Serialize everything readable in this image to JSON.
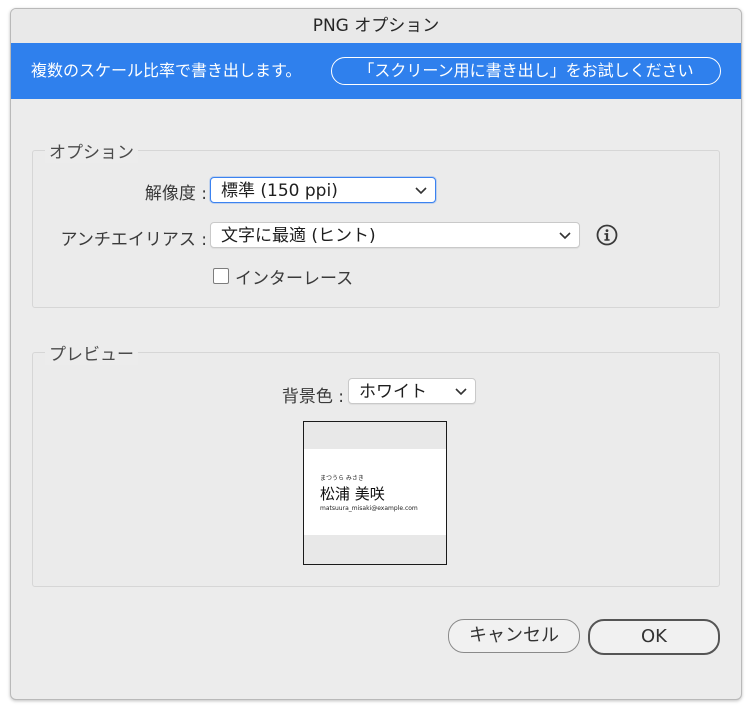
{
  "window": {
    "title": "PNG オプション"
  },
  "banner": {
    "text": "複数のスケール比率で書き出します。",
    "button_label": "「スクリーン用に書き出し」をお試しください",
    "color": "#2f80ed"
  },
  "options": {
    "group_title": "オプション",
    "resolution": {
      "label": "解像度 :",
      "value": "標準 (150 ppi)"
    },
    "antialias": {
      "label": "アンチエイリアス :",
      "value": "文字に最適 (ヒント)",
      "info_icon": "info-icon"
    },
    "interlace": {
      "label": "インターレース",
      "checked": false
    }
  },
  "preview": {
    "group_title": "プレビュー",
    "background": {
      "label": "背景色 :",
      "value": "ホワイト"
    },
    "card": {
      "kana": "まつうら みさき",
      "name": "松浦 美咲",
      "email": "matsuura_misaki@example.com"
    }
  },
  "footer": {
    "cancel_label": "キャンセル",
    "ok_label": "OK"
  }
}
